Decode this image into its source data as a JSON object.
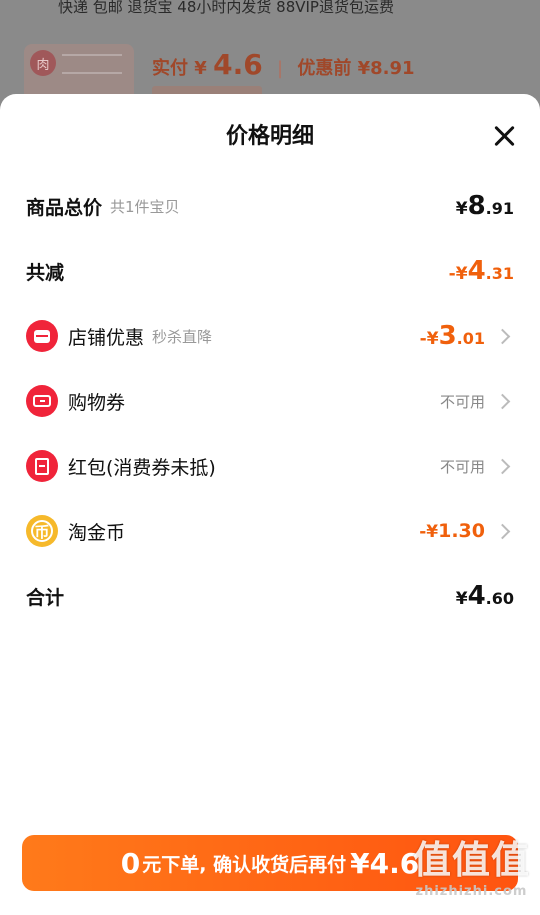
{
  "background_page": {
    "top_text": "快递 包邮  退货宝  48小时内发货  88VIP退货包运费",
    "thumb_badge": "肉",
    "price_label": "实付",
    "price_currency": "¥",
    "price_value": "4.6",
    "discount_before": "优惠前 ¥8.91"
  },
  "sheet": {
    "title": "价格明细",
    "rows": [
      {
        "label": "商品总价",
        "sub": "共1件宝贝",
        "currency": "¥",
        "int": "8",
        "dec": ".91"
      },
      {
        "label": "共减",
        "currency": "-¥",
        "int": "4",
        "dec": ".31"
      },
      {
        "label": "店铺优惠",
        "sub": "秒杀直降",
        "currency": "-¥",
        "int": "3",
        "dec": ".01",
        "icon": "store-icon"
      },
      {
        "label": "购物券",
        "status": "不可用",
        "icon": "coupon-icon"
      },
      {
        "label": "红包(消费券未抵)",
        "status": "不可用",
        "icon": "red-packet-icon"
      },
      {
        "label": "淘金币",
        "currency": "-¥",
        "int": "1.30",
        "dec": "",
        "icon": "taojinbi-coin-icon"
      },
      {
        "label": "合计",
        "currency": "¥",
        "int": "4",
        "dec": ".60"
      }
    ]
  },
  "cta": {
    "num": "0",
    "text": "元下单, 确认收货后再付",
    "amount": "¥4.6"
  },
  "watermark": {
    "big": "值值值",
    "small": "zhizhizhi.com"
  },
  "colors": {
    "accent_orange": "#f0600c",
    "icon_red": "#f0243a",
    "icon_gold": "#f6b92b"
  }
}
